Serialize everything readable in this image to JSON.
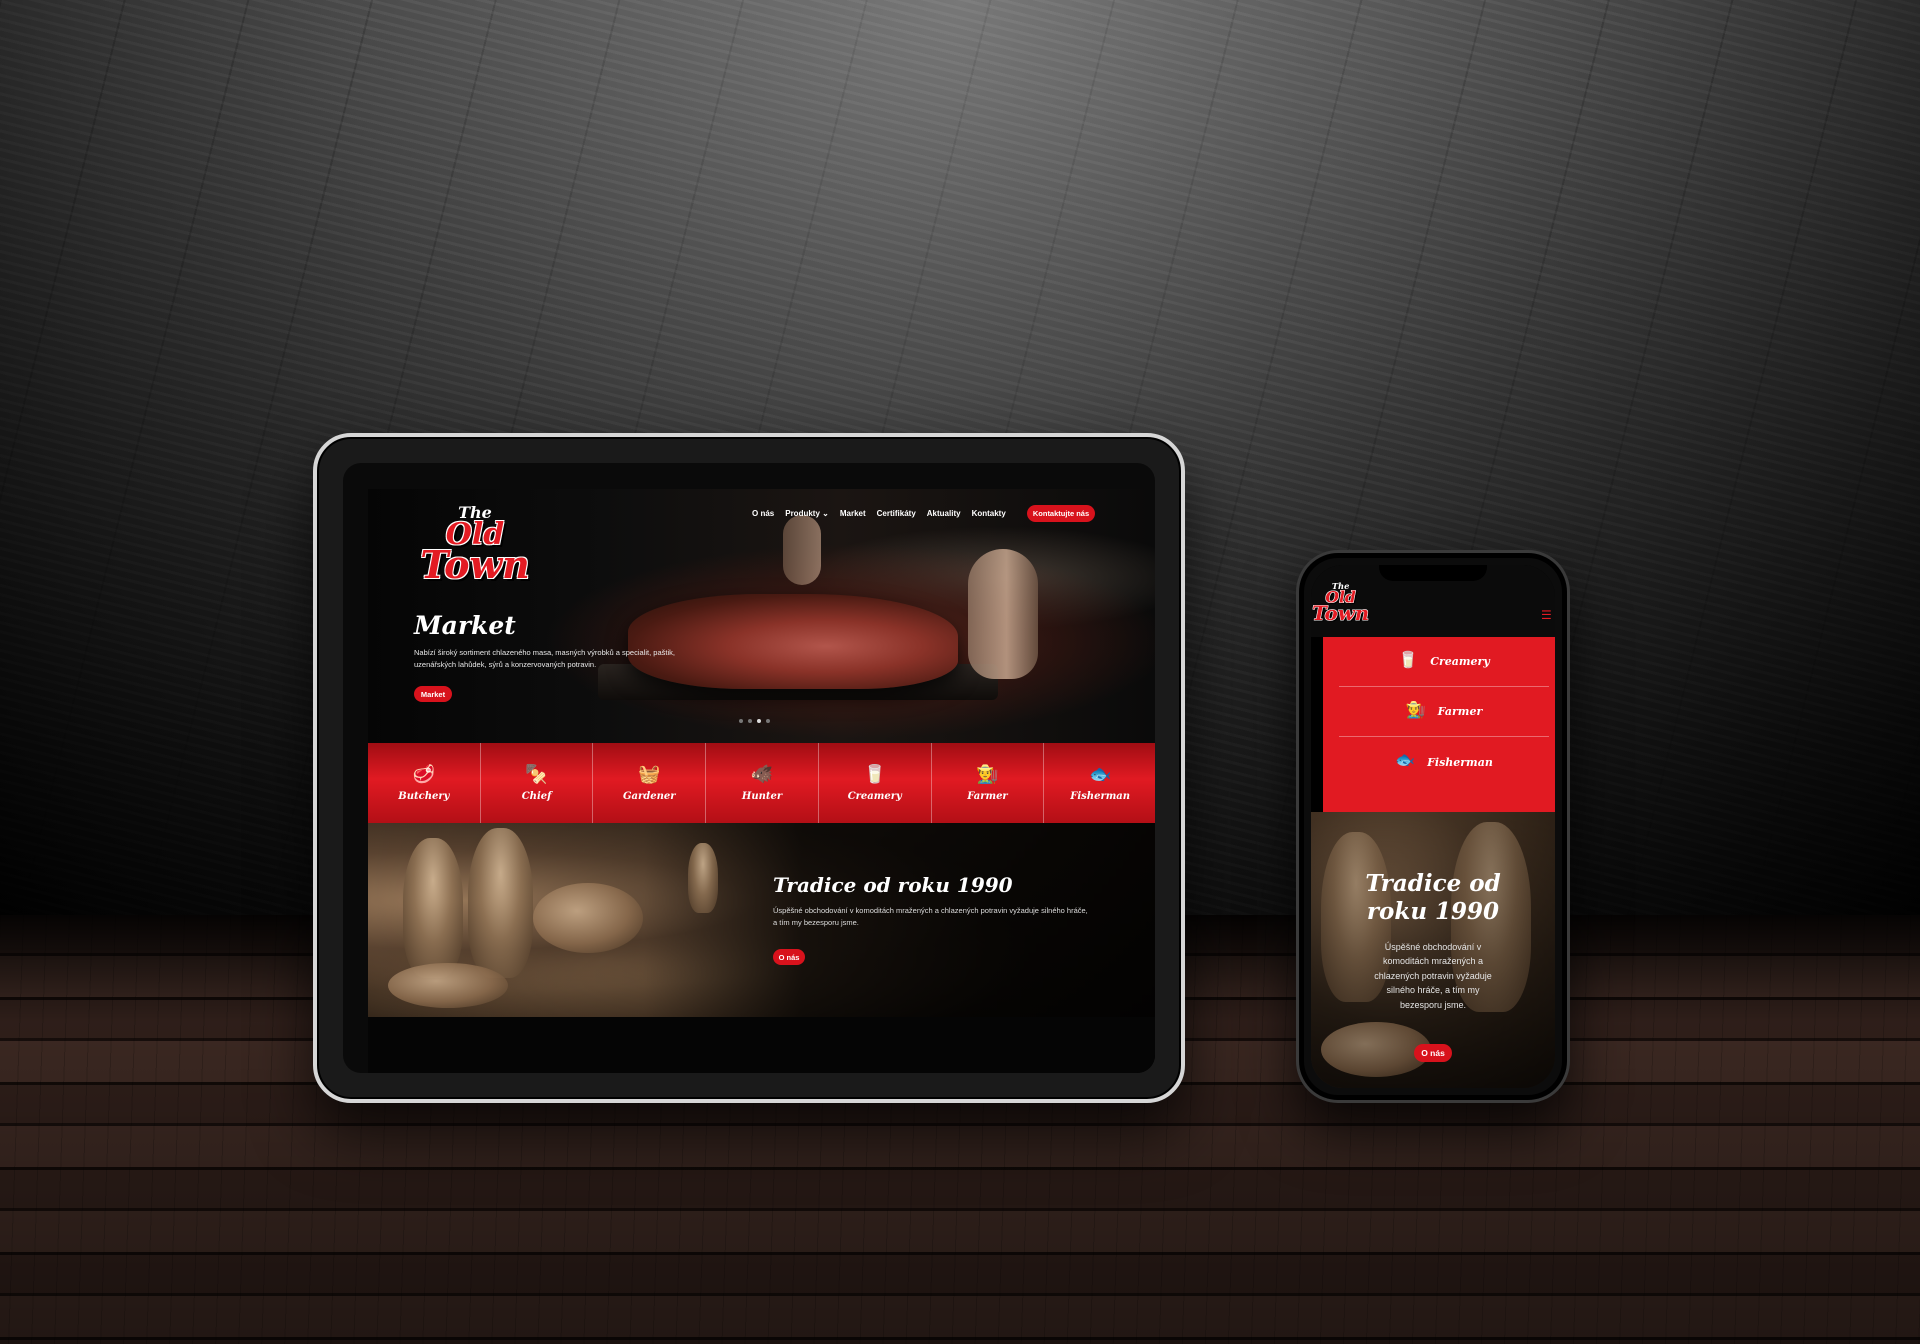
{
  "brand": {
    "the": "The",
    "old": "Old",
    "town": "Town"
  },
  "nav": {
    "items": [
      "O nás",
      "Produkty ⌄",
      "Market",
      "Certifikáty",
      "Aktuality",
      "Kontakty"
    ],
    "cta": "Kontaktujte nás"
  },
  "hero": {
    "title": "Market",
    "text": "Nabízí široký sortiment chlazeného masa, masných výrobků a specialit, paštik, uzenářských lahůdek, sýrů a konzervovaných potravin.",
    "button": "Market",
    "slides_total": 4,
    "slide_active": 3
  },
  "categories": [
    {
      "label": "Butchery",
      "icon": "🥩",
      "icon_name": "meat-icon"
    },
    {
      "label": "Chief",
      "icon": "🍢",
      "icon_name": "skewer-icon"
    },
    {
      "label": "Gardener",
      "icon": "🧺",
      "icon_name": "basket-icon"
    },
    {
      "label": "Hunter",
      "icon": "🐗",
      "icon_name": "boar-icon"
    },
    {
      "label": "Creamery",
      "icon": "🥛",
      "icon_name": "milk-icon"
    },
    {
      "label": "Farmer",
      "icon": "👨‍🌾",
      "icon_name": "farmer-icon"
    },
    {
      "label": "Fisherman",
      "icon": "🐟",
      "icon_name": "fish-icon"
    }
  ],
  "mobile_categories": [
    {
      "label": "Creamery",
      "icon": "🥛",
      "icon_name": "milk-icon"
    },
    {
      "label": "Farmer",
      "icon": "👨‍🌾",
      "icon_name": "farmer-icon"
    },
    {
      "label": "Fisherman",
      "icon": "🐟",
      "icon_name": "fish-icon"
    }
  ],
  "tradition": {
    "title": "Tradice od roku 1990",
    "text": "Úspěšné obchodování v komoditách mražených a chlazených potravin vyžaduje silného hráče, a tím my bezesporu jsme.",
    "button": "O nás"
  },
  "mobile": {
    "menu_icon": "☰",
    "scroll_top_icon": "⌃",
    "tradition_title_line1": "Tradice od",
    "tradition_title_line2": "roku 1990"
  },
  "colors": {
    "accent": "#e11a22",
    "background": "#000000",
    "text": "#ffffff"
  }
}
